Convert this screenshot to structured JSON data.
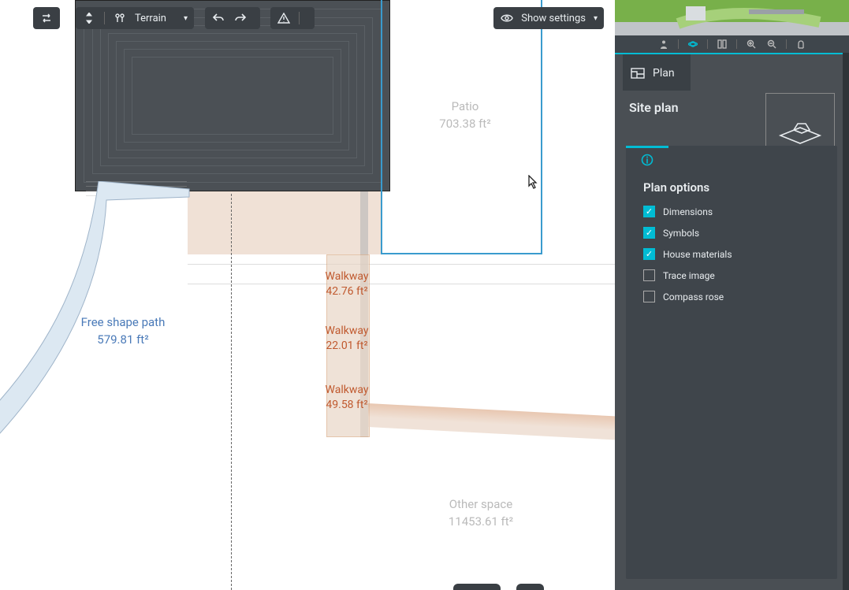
{
  "toolbar": {
    "swap_tooltip": "Swap",
    "terrain_label": "Terrain",
    "undo_tooltip": "Undo",
    "redo_tooltip": "Redo",
    "warn_tooltip": "Warnings",
    "show_settings_label": "Show settings"
  },
  "canvas": {
    "patio": {
      "name": "Patio",
      "area": "703.38 ft²"
    },
    "walkways": [
      {
        "name": "Walkway",
        "area": "42.76 ft²"
      },
      {
        "name": "Walkway",
        "area": "22.01 ft²"
      },
      {
        "name": "Walkway",
        "area": "49.58 ft²"
      }
    ],
    "path": {
      "name": "Free shape path",
      "area": "579.81 ft²"
    },
    "other": {
      "name": "Other space",
      "area": "11453.61 ft²"
    }
  },
  "right": {
    "plan_tab_label": "Plan",
    "site_plan_title": "Site plan",
    "options": {
      "title": "Plan options",
      "items": [
        {
          "label": "Dimensions",
          "checked": true
        },
        {
          "label": "Symbols",
          "checked": true
        },
        {
          "label": "House materials",
          "checked": true
        },
        {
          "label": "Trace image",
          "checked": false
        },
        {
          "label": "Compass rose",
          "checked": false
        }
      ]
    }
  },
  "colors": {
    "teal": "#00bcd4"
  }
}
